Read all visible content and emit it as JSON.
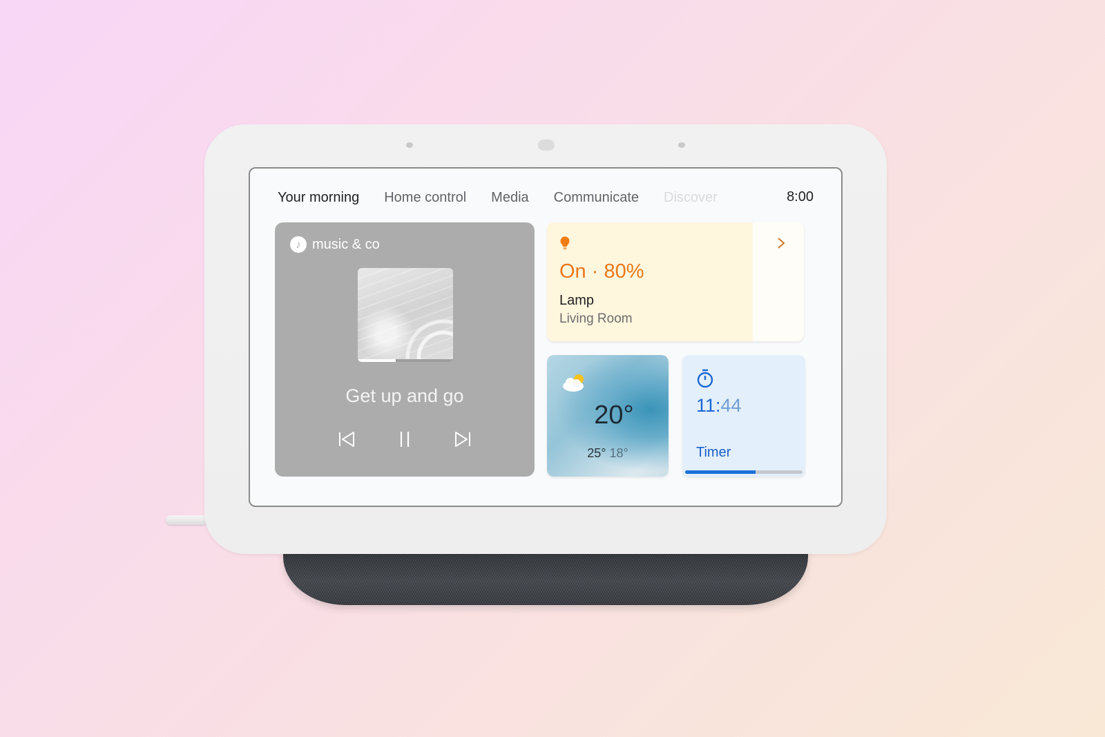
{
  "device": {
    "tabs": [
      {
        "label": "Your morning",
        "state": "active"
      },
      {
        "label": "Home control",
        "state": "normal"
      },
      {
        "label": "Media",
        "state": "normal"
      },
      {
        "label": "Communicate",
        "state": "normal"
      },
      {
        "label": "Discover",
        "state": "faded"
      }
    ],
    "clock": "8:00"
  },
  "media": {
    "source": "music & co",
    "source_icon": "music-note-icon",
    "title": "Get up and go",
    "progress": 0.4,
    "controls": [
      "skip-previous-icon",
      "pause-icon",
      "skip-next-icon"
    ]
  },
  "lamp": {
    "icon": "lightbulb-icon",
    "status": "On · 80%",
    "brightness": 0.8,
    "name": "Lamp",
    "room": "Living Room",
    "accent": "#e8781a"
  },
  "weather": {
    "icon": "partly-cloudy-icon",
    "temperature": "20°",
    "high": "25°",
    "low": "18°"
  },
  "timer": {
    "icon": "stopwatch-icon",
    "value_main": "11:",
    "value_seconds": "44",
    "label": "Timer",
    "progress": 0.6,
    "accent": "#1a6fd8"
  }
}
